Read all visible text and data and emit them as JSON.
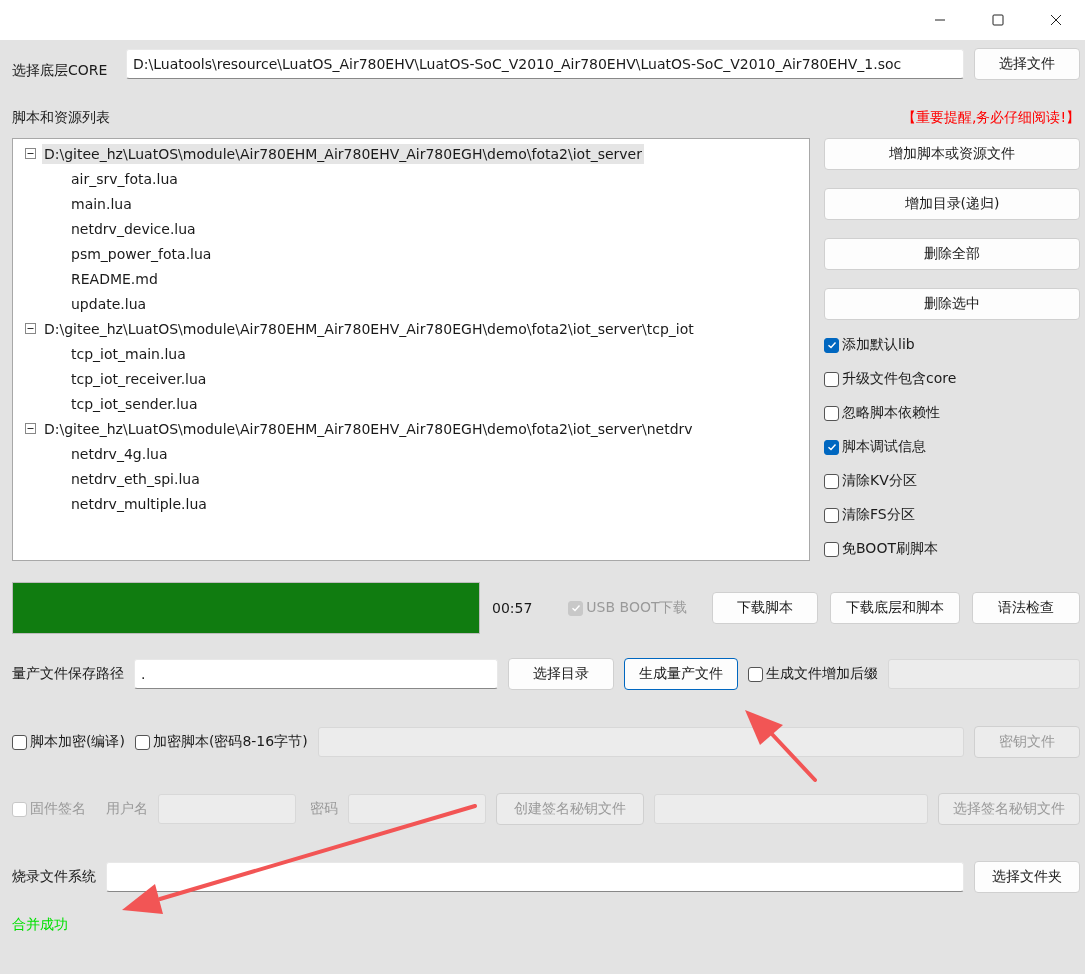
{
  "core": {
    "label": "选择底层CORE",
    "value": "D:\\Luatools\\resource\\LuatOS_Air780EHV\\LuatOS-SoC_V2010_Air780EHV\\LuatOS-SoC_V2010_Air780EHV_1.soc",
    "button": "选择文件"
  },
  "list_title": "脚本和资源列表",
  "notice": "【重要提醒,务必仔细阅读!】",
  "tree": [
    {
      "label": "D:\\gitee_hz\\LuatOS\\module\\Air780EHM_Air780EHV_Air780EGH\\demo\\fota2\\iot_server",
      "expanded": true,
      "selected": true,
      "children": [
        {
          "label": "air_srv_fota.lua"
        },
        {
          "label": "main.lua"
        },
        {
          "label": "netdrv_device.lua"
        },
        {
          "label": "psm_power_fota.lua"
        },
        {
          "label": "README.md"
        },
        {
          "label": "update.lua"
        }
      ]
    },
    {
      "label": "D:\\gitee_hz\\LuatOS\\module\\Air780EHM_Air780EHV_Air780EGH\\demo\\fota2\\iot_server\\tcp_iot",
      "expanded": true,
      "selected": false,
      "children": [
        {
          "label": "tcp_iot_main.lua"
        },
        {
          "label": "tcp_iot_receiver.lua"
        },
        {
          "label": "tcp_iot_sender.lua"
        }
      ]
    },
    {
      "label": "D:\\gitee_hz\\LuatOS\\module\\Air780EHM_Air780EHV_Air780EGH\\demo\\fota2\\iot_server\\netdrv",
      "expanded": true,
      "selected": false,
      "children": [
        {
          "label": "netdrv_4g.lua"
        },
        {
          "label": "netdrv_eth_spi.lua"
        },
        {
          "label": "netdrv_multiple.lua"
        }
      ]
    }
  ],
  "side_buttons": [
    "增加脚本或资源文件",
    "增加目录(递归)",
    "删除全部",
    "删除选中"
  ],
  "options": [
    {
      "label": "添加默认lib",
      "checked": true
    },
    {
      "label": "升级文件包含core",
      "checked": false
    },
    {
      "label": "忽略脚本依赖性",
      "checked": false
    },
    {
      "label": "脚本调试信息",
      "checked": true
    },
    {
      "label": "清除KV分区",
      "checked": false
    },
    {
      "label": "清除FS分区",
      "checked": false
    },
    {
      "label": "免BOOT刷脚本",
      "checked": false
    }
  ],
  "progress": {
    "level": 1,
    "time": "00:57"
  },
  "usb_boot": {
    "label": "USB BOOT下载",
    "checked": true,
    "disabled": true
  },
  "download_buttons": [
    "下载脚本",
    "下载底层和脚本",
    "语法检查"
  ],
  "output": {
    "label": "量产文件保存路径",
    "value": ".",
    "choose": "选择目录",
    "generate": "生成量产文件",
    "suffix": {
      "label": "生成文件增加后缀",
      "checked": false
    }
  },
  "encrypt": {
    "compile": {
      "label": "脚本加密(编译)",
      "checked": false
    },
    "encrypt": {
      "label": "加密脚本(密码8-16字节)",
      "checked": false
    },
    "key_button": "密钥文件"
  },
  "sign": {
    "checkbox": {
      "label": "固件签名",
      "checked": false,
      "disabled": true
    },
    "user_label": "用户名",
    "password_label": "密码",
    "create_button": "创建签名秘钥文件",
    "choose_button": "选择签名秘钥文件"
  },
  "burn": {
    "label": "烧录文件系统",
    "button": "选择文件夹"
  },
  "status": "合并成功"
}
